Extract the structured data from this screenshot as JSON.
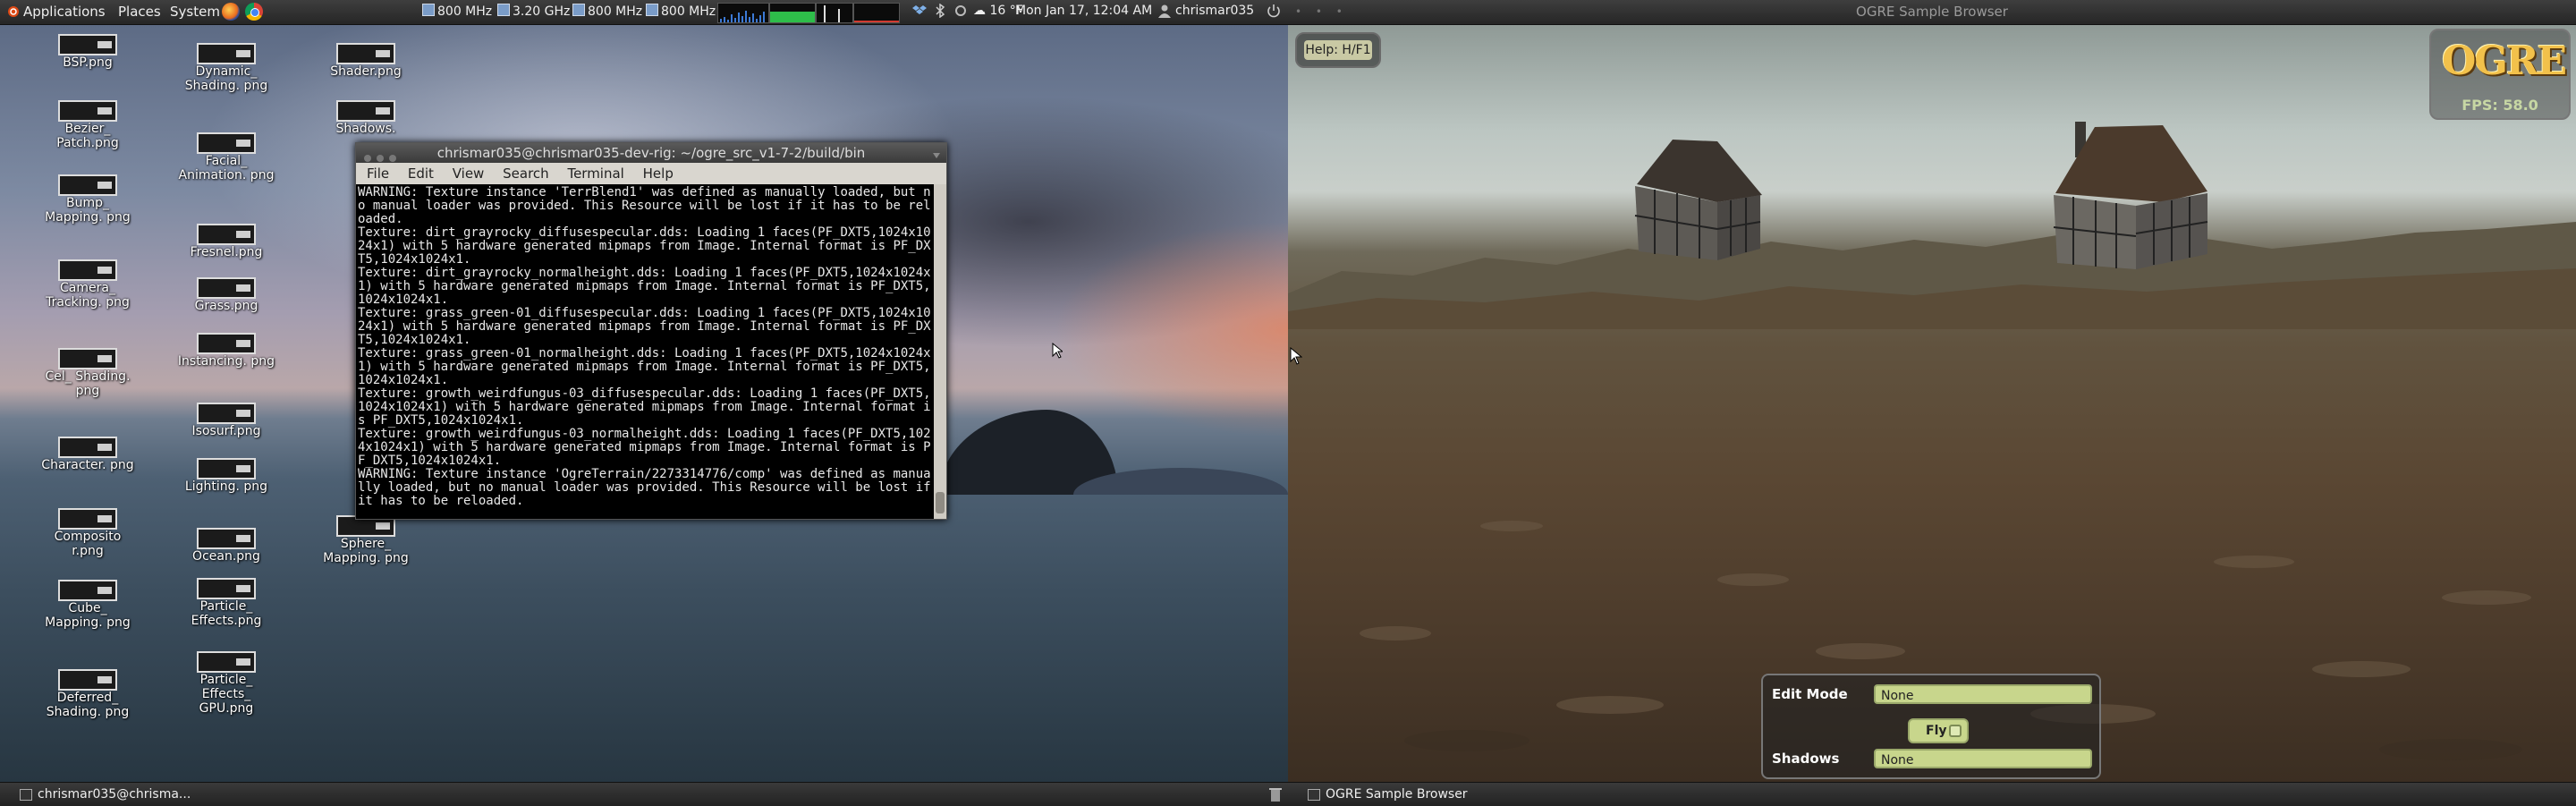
{
  "top_panel": {
    "menus": [
      "Applications",
      "Places",
      "System"
    ],
    "cpu_freqs": [
      "800 MHz",
      "3.20 GHz",
      "800 MHz",
      "800 MHz"
    ],
    "weather": "16 °F",
    "datetime": "Mon Jan 17, 12:04 AM",
    "user": "chrismar035"
  },
  "desktop_icons": [
    "BSP.png",
    "Bezier_ Patch.png",
    "Bump_ Mapping. png",
    "Camera_ Tracking. png",
    "Cel_ Shading. png",
    "Character. png",
    "Composito r.png",
    "Cube_ Mapping. png",
    "Deferred_ Shading. png",
    "Dynamic_ Shading. png",
    "Facial_ Animation. png",
    "Fresnel.png",
    "Grass.png",
    "Instancing. png",
    "Isosurf.png",
    "Lighting. png",
    "Ocean.png",
    "Particle_ Effects.png",
    "Particle_ Effects_ GPU.png",
    "Shader.png",
    "Shadows.",
    "Sphere_ Mapping. png"
  ],
  "terminal": {
    "title": "chrismar035@chrismar035-dev-rig: ~/ogre_src_v1-7-2/build/bin",
    "menu": [
      "File",
      "Edit",
      "View",
      "Search",
      "Terminal",
      "Help"
    ],
    "output": "WARNING: Texture instance 'TerrBlend1' was defined as manually loaded, but no manual loader was provided. This Resource will be lost if it has to be reloaded.\nTexture: dirt_grayrocky_diffusespecular.dds: Loading 1 faces(PF_DXT5,1024x1024x1) with 5 hardware generated mipmaps from Image. Internal format is PF_DXT5,1024x1024x1.\nTexture: dirt_grayrocky_normalheight.dds: Loading 1 faces(PF_DXT5,1024x1024x1) with 5 hardware generated mipmaps from Image. Internal format is PF_DXT5,1024x1024x1.\nTexture: grass_green-01_diffusespecular.dds: Loading 1 faces(PF_DXT5,1024x1024x1) with 5 hardware generated mipmaps from Image. Internal format is PF_DXT5,1024x1024x1.\nTexture: grass_green-01_normalheight.dds: Loading 1 faces(PF_DXT5,1024x1024x1) with 5 hardware generated mipmaps from Image. Internal format is PF_DXT5,1024x1024x1.\nTexture: growth_weirdfungus-03_diffusespecular.dds: Loading 1 faces(PF_DXT5,1024x1024x1) with 5 hardware generated mipmaps from Image. Internal format is PF_DXT5,1024x1024x1.\nTexture: growth_weirdfungus-03_normalheight.dds: Loading 1 faces(PF_DXT5,1024x1024x1) with 5 hardware generated mipmaps from Image. Internal format is PF_DXT5,1024x1024x1.\nWARNING: Texture instance 'OgreTerrain/2273314776/comp' was defined as manually loaded, but no manual loader was provided. This Resource will be lost if it has to be reloaded."
  },
  "ogre": {
    "window_title": "OGRE Sample Browser",
    "help": "Help:  H/F1",
    "logo_text": "OGRE",
    "fps": "FPS: 58.0",
    "edit_mode_label": "Edit Mode",
    "edit_mode_value": "None",
    "fly_label": "Fly",
    "fly_checked": false,
    "shadows_label": "Shadows",
    "shadows_value": "None"
  },
  "taskbar": [
    "chrismar035@chrisma...",
    "OGRE Sample Browser"
  ]
}
